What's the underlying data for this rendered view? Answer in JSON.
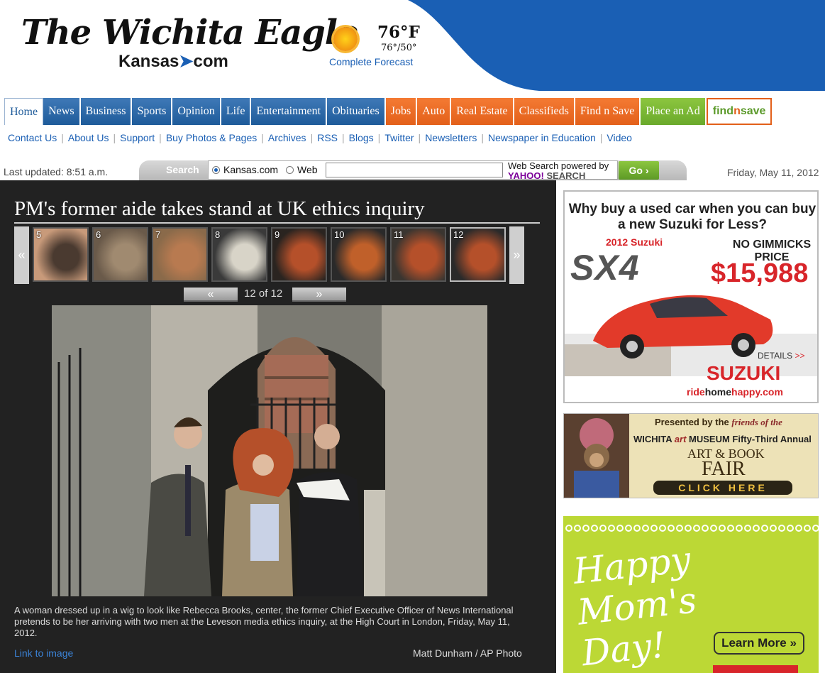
{
  "header": {
    "masthead": "The Wichita Eagle",
    "site_prefix": "Kansas",
    "site_suffix": "com",
    "weather": {
      "temp": "76°F",
      "hilo": "76°/50°",
      "forecast_link": "Complete Forecast",
      "icon": "sun-icon"
    }
  },
  "nav": {
    "tabs": [
      {
        "label": "Home",
        "style": "home"
      },
      {
        "label": "News",
        "style": "blue"
      },
      {
        "label": "Business",
        "style": "blue"
      },
      {
        "label": "Sports",
        "style": "blue"
      },
      {
        "label": "Opinion",
        "style": "blue"
      },
      {
        "label": "Life",
        "style": "blue"
      },
      {
        "label": "Entertainment",
        "style": "blue"
      },
      {
        "label": "Obituaries",
        "style": "blue"
      },
      {
        "label": "Jobs",
        "style": "orange"
      },
      {
        "label": "Auto",
        "style": "orange"
      },
      {
        "label": "Real Estate",
        "style": "orange"
      },
      {
        "label": "Classifieds",
        "style": "orange"
      },
      {
        "label": "Find n Save",
        "style": "orange"
      },
      {
        "label": "Place an Ad",
        "style": "green"
      }
    ],
    "findsave_logo": {
      "part1": "find",
      "part2": "n",
      "part3": "save"
    }
  },
  "subnav": [
    "Contact Us",
    "About Us",
    "Support",
    "Buy Photos & Pages",
    "Archives",
    "RSS",
    "Blogs",
    "Twitter",
    "Newsletters",
    "Newspaper in Education",
    "Video"
  ],
  "search": {
    "last_updated": "Last updated: 8:51 a.m.",
    "label": "Search",
    "option1": "Kansas.com",
    "option2": "Web",
    "selected": "Kansas.com",
    "input_value": "",
    "powered_line1": "Web Search powered by",
    "powered_yahoo": "YAHOO!",
    "powered_search": "SEARCH",
    "go": "Go ›",
    "date": "Friday, May 11, 2012"
  },
  "gallery": {
    "headline": "PM's former aide takes stand at UK ethics inquiry",
    "prev_arrow": "«",
    "next_arrow": "»",
    "thumbnails": [
      "5",
      "6",
      "7",
      "8",
      "9",
      "10",
      "11",
      "12"
    ],
    "active_thumbnail": "12",
    "pager_prev": "«",
    "pager_next": "»",
    "pager_count": "12 of 12",
    "caption": "A woman dressed up in a wig to look like Rebecca Brooks, center, the former Chief Executive Officer of News International pretends to be her arriving with two men at the Leveson media ethics inquiry, at the High Court in London, Friday, May 11, 2012.",
    "link": "Link to image",
    "credit": "Matt Dunham / AP Photo"
  },
  "ads": {
    "suzuki": {
      "question": "Why buy a used car when you can buy a new Suzuki for Less?",
      "model_year": "2012 Suzuki",
      "model": "SX4",
      "no_gimmicks": "NO GIMMICKS PRICE",
      "price": "$15,988",
      "details": "DETAILS",
      "details_arrows": ">>",
      "brand": "SUZUKI",
      "site_ride": "ride",
      "site_home": "home",
      "site_rest": "happy.com"
    },
    "museum": {
      "presented": "Presented by the",
      "friends": "friends of the",
      "museum_pre": "WICHITA",
      "museum_art": "art",
      "museum_post": "MUSEUM Fifty-Third Annual",
      "artbook": "ART & BOOK",
      "fair": "FAIR",
      "click": "CLICK HERE"
    },
    "mothers": {
      "happy": "Happy",
      "moms": "Mom's",
      "day": "Day!",
      "learn_more": "Learn More »"
    }
  },
  "colors": {
    "brand_blue": "#1e5b9a",
    "orange": "#e3601a",
    "green": "#6aa92b",
    "dark_bg": "#222222"
  }
}
